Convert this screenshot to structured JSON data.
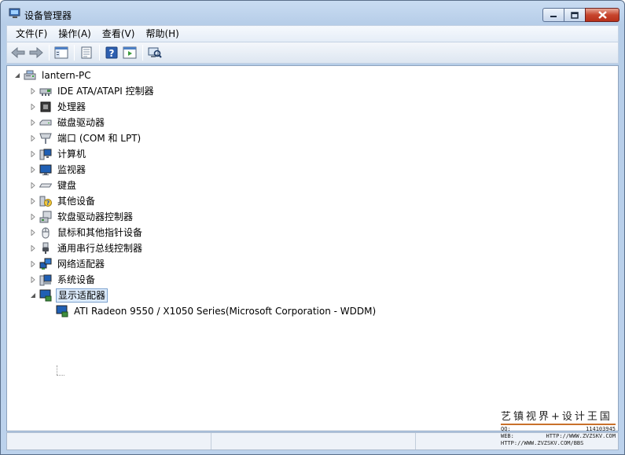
{
  "window": {
    "title": "设备管理器"
  },
  "menu": [
    "文件(F)",
    "操作(A)",
    "查看(V)",
    "帮助(H)"
  ],
  "toolbar": {
    "buttons": [
      "back-arrow-icon",
      "forward-arrow-icon",
      "show-hide-console-tree-icon",
      "properties-icon",
      "help-icon",
      "action-pane-icon",
      "scan-hardware-icon"
    ]
  },
  "tree": {
    "root": "lantern-PC",
    "categories": [
      {
        "label": "IDE ATA/ATAPI 控制器",
        "icon": "ide-controller-icon"
      },
      {
        "label": "处理器",
        "icon": "processor-icon"
      },
      {
        "label": "磁盘驱动器",
        "icon": "disk-drive-icon"
      },
      {
        "label": "端口 (COM 和 LPT)",
        "icon": "port-icon"
      },
      {
        "label": "计算机",
        "icon": "computer-icon"
      },
      {
        "label": "监视器",
        "icon": "monitor-icon"
      },
      {
        "label": "键盘",
        "icon": "keyboard-icon"
      },
      {
        "label": "其他设备",
        "icon": "unknown-device-icon"
      },
      {
        "label": "软盘驱动器控制器",
        "icon": "floppy-controller-icon"
      },
      {
        "label": "鼠标和其他指针设备",
        "icon": "mouse-icon"
      },
      {
        "label": "通用串行总线控制器",
        "icon": "usb-icon"
      },
      {
        "label": "网络适配器",
        "icon": "network-adapter-icon"
      },
      {
        "label": "系统设备",
        "icon": "system-device-icon"
      },
      {
        "label": "显示适配器",
        "icon": "display-adapter-icon",
        "expanded": true,
        "selected": true
      }
    ],
    "child": "ATI Radeon 9550 / X1050 Series(Microsoft Corporation - WDDM)"
  },
  "watermark": {
    "title": "艺镇视界+设计王国",
    "qq_label": "QQ:",
    "qq_value": "114103945",
    "web_label": "WEB:",
    "web_value": "HTTP://WWW.ZVZSKV.COM",
    "bbs_value": "HTTP://WWW.ZVZSKV.COM/BBS"
  }
}
